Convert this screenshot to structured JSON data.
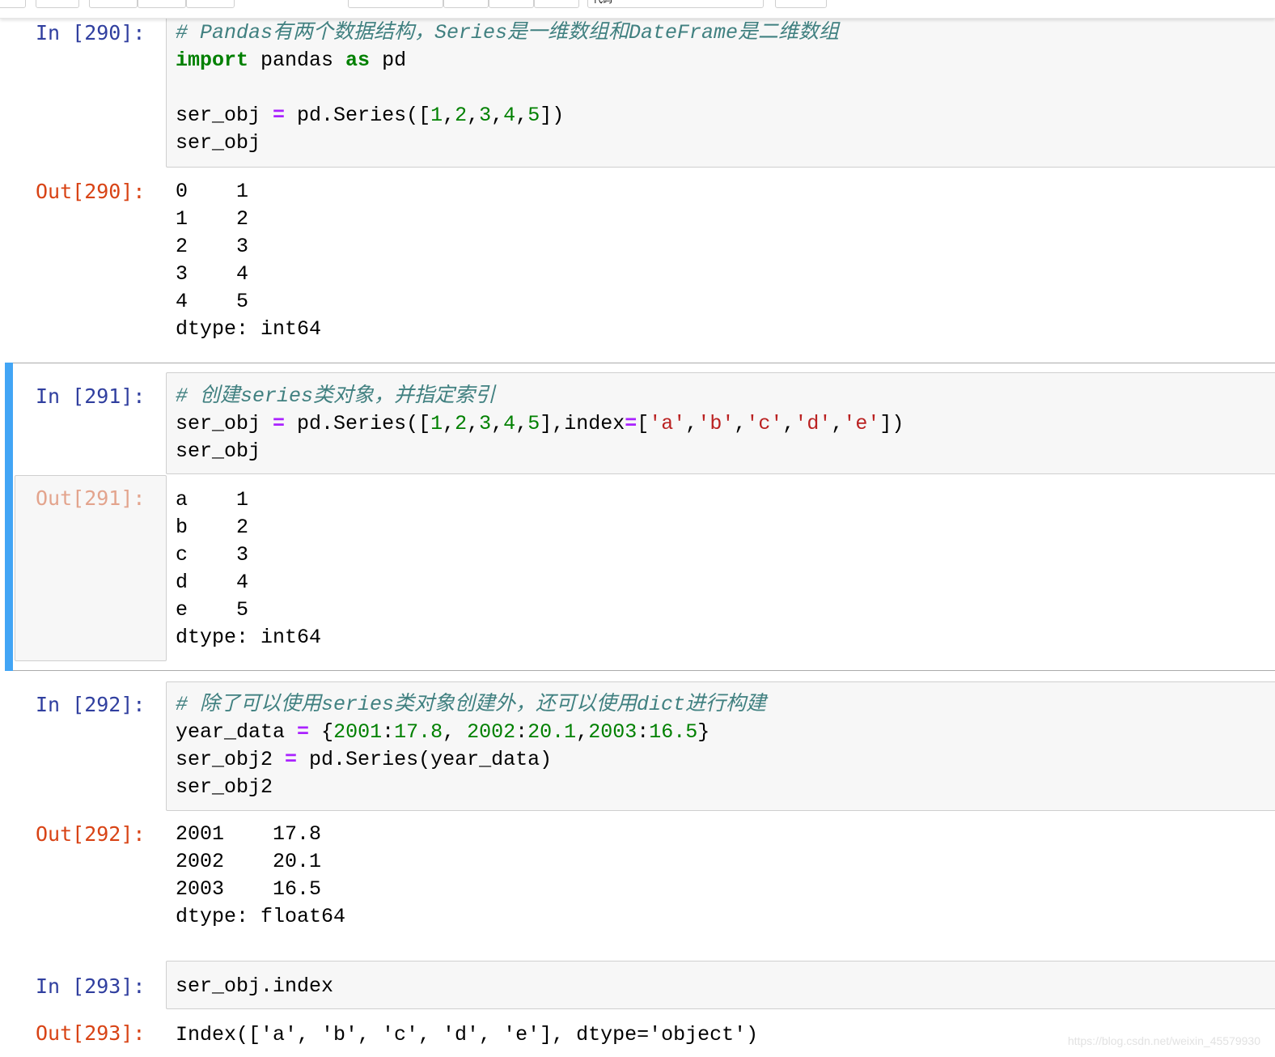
{
  "toolbar": {
    "cell_type_select": "代码"
  },
  "cells": [
    {
      "in_prompt": "In [290]:",
      "code_lines": [
        [
          {
            "t": "cm",
            "v": "# Pandas有两个数据结构，Series是一维数组和DateFrame是二维数组"
          }
        ],
        [
          {
            "t": "kw",
            "v": "import"
          },
          {
            "t": "",
            "v": " pandas "
          },
          {
            "t": "kw",
            "v": "as"
          },
          {
            "t": "",
            "v": " pd"
          }
        ],
        [
          {
            "t": "",
            "v": ""
          }
        ],
        [
          {
            "t": "",
            "v": "ser_obj "
          },
          {
            "t": "op",
            "v": "="
          },
          {
            "t": "",
            "v": " pd.Series(["
          },
          {
            "t": "num",
            "v": "1"
          },
          {
            "t": "",
            "v": ","
          },
          {
            "t": "num",
            "v": "2"
          },
          {
            "t": "",
            "v": ","
          },
          {
            "t": "num",
            "v": "3"
          },
          {
            "t": "",
            "v": ","
          },
          {
            "t": "num",
            "v": "4"
          },
          {
            "t": "",
            "v": ","
          },
          {
            "t": "num",
            "v": "5"
          },
          {
            "t": "",
            "v": "])"
          }
        ],
        [
          {
            "t": "",
            "v": "ser_obj"
          }
        ]
      ],
      "out_prompt": "Out[290]:",
      "output_lines": [
        "0    1",
        "1    2",
        "2    3",
        "3    4",
        "4    5",
        "dtype: int64"
      ]
    },
    {
      "in_prompt": "In [291]:",
      "code_lines": [
        [
          {
            "t": "cm",
            "v": "# 创建series类对象，并指定索引"
          }
        ],
        [
          {
            "t": "",
            "v": "ser_obj "
          },
          {
            "t": "op",
            "v": "="
          },
          {
            "t": "",
            "v": " pd.Series(["
          },
          {
            "t": "num",
            "v": "1"
          },
          {
            "t": "",
            "v": ","
          },
          {
            "t": "num",
            "v": "2"
          },
          {
            "t": "",
            "v": ","
          },
          {
            "t": "num",
            "v": "3"
          },
          {
            "t": "",
            "v": ","
          },
          {
            "t": "num",
            "v": "4"
          },
          {
            "t": "",
            "v": ","
          },
          {
            "t": "num",
            "v": "5"
          },
          {
            "t": "",
            "v": "],index"
          },
          {
            "t": "op",
            "v": "="
          },
          {
            "t": "",
            "v": "["
          },
          {
            "t": "str",
            "v": "'a'"
          },
          {
            "t": "",
            "v": ","
          },
          {
            "t": "str",
            "v": "'b'"
          },
          {
            "t": "",
            "v": ","
          },
          {
            "t": "str",
            "v": "'c'"
          },
          {
            "t": "",
            "v": ","
          },
          {
            "t": "str",
            "v": "'d'"
          },
          {
            "t": "",
            "v": ","
          },
          {
            "t": "str",
            "v": "'e'"
          },
          {
            "t": "",
            "v": "])"
          }
        ],
        [
          {
            "t": "",
            "v": "ser_obj"
          }
        ]
      ],
      "out_prompt": "Out[291]:",
      "output_lines": [
        "a    1",
        "b    2",
        "c    3",
        "d    4",
        "e    5",
        "dtype: int64"
      ]
    },
    {
      "in_prompt": "In [292]:",
      "code_lines": [
        [
          {
            "t": "cm",
            "v": "# 除了可以使用series类对象创建外，还可以使用dict进行构建"
          }
        ],
        [
          {
            "t": "",
            "v": "year_data "
          },
          {
            "t": "op",
            "v": "="
          },
          {
            "t": "",
            "v": " {"
          },
          {
            "t": "num",
            "v": "2001"
          },
          {
            "t": "",
            "v": ":"
          },
          {
            "t": "num",
            "v": "17.8"
          },
          {
            "t": "",
            "v": ", "
          },
          {
            "t": "num",
            "v": "2002"
          },
          {
            "t": "",
            "v": ":"
          },
          {
            "t": "num",
            "v": "20.1"
          },
          {
            "t": "",
            "v": ","
          },
          {
            "t": "num",
            "v": "2003"
          },
          {
            "t": "",
            "v": ":"
          },
          {
            "t": "num",
            "v": "16.5"
          },
          {
            "t": "",
            "v": "}"
          }
        ],
        [
          {
            "t": "",
            "v": "ser_obj2 "
          },
          {
            "t": "op",
            "v": "="
          },
          {
            "t": "",
            "v": " pd.Series(year_data)"
          }
        ],
        [
          {
            "t": "",
            "v": "ser_obj2"
          }
        ]
      ],
      "out_prompt": "Out[292]:",
      "output_lines": [
        "2001    17.8",
        "2002    20.1",
        "2003    16.5",
        "dtype: float64"
      ]
    },
    {
      "in_prompt": "In [293]:",
      "code_lines": [
        [
          {
            "t": "",
            "v": "ser_obj.index"
          }
        ]
      ],
      "out_prompt": "Out[293]:",
      "output_lines": [
        "Index(['a', 'b', 'c', 'd', 'e'], dtype='object')"
      ]
    }
  ],
  "watermark": "https://blog.csdn.net/weixin_45579930"
}
